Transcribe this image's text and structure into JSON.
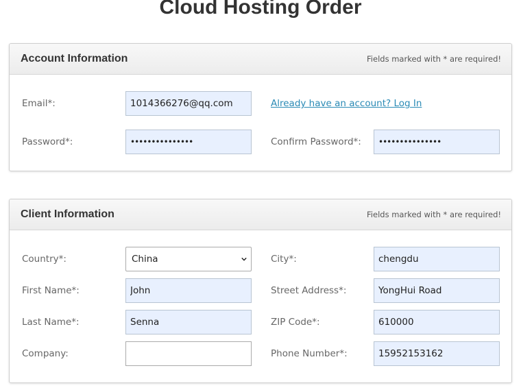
{
  "page": {
    "title": "Cloud Hosting Order"
  },
  "account": {
    "heading": "Account Information",
    "required_note": "Fields marked with * are required!",
    "email_label": "Email*:",
    "email_value": "1014366276@qq.com",
    "login_link": "Already have an account? Log In",
    "password_label": "Password*:",
    "password_value": "passwordpasswd1",
    "confirm_label": "Confirm Password*:",
    "confirm_value": "passwordpasswd1"
  },
  "client": {
    "heading": "Client Information",
    "required_note": "Fields marked with * are required!",
    "country_label": "Country*:",
    "country_value": "China",
    "city_label": "City*:",
    "city_value": "chengdu",
    "first_name_label": "First Name*:",
    "first_name_value": "John",
    "street_label": "Street Address*:",
    "street_value": "YongHui Road",
    "last_name_label": "Last Name*:",
    "last_name_value": "Senna",
    "zip_label": "ZIP Code*:",
    "zip_value": "610000",
    "company_label": "Company:",
    "company_value": "",
    "phone_label": "Phone Number*:",
    "phone_value": "15952153162"
  },
  "icons": {
    "country_dropdown": "chevron-down-icon"
  },
  "colors": {
    "autofill_background": "#e8f0fe",
    "link": "#2a8ab5",
    "label_text": "#666666",
    "heading_text": "#333333"
  }
}
